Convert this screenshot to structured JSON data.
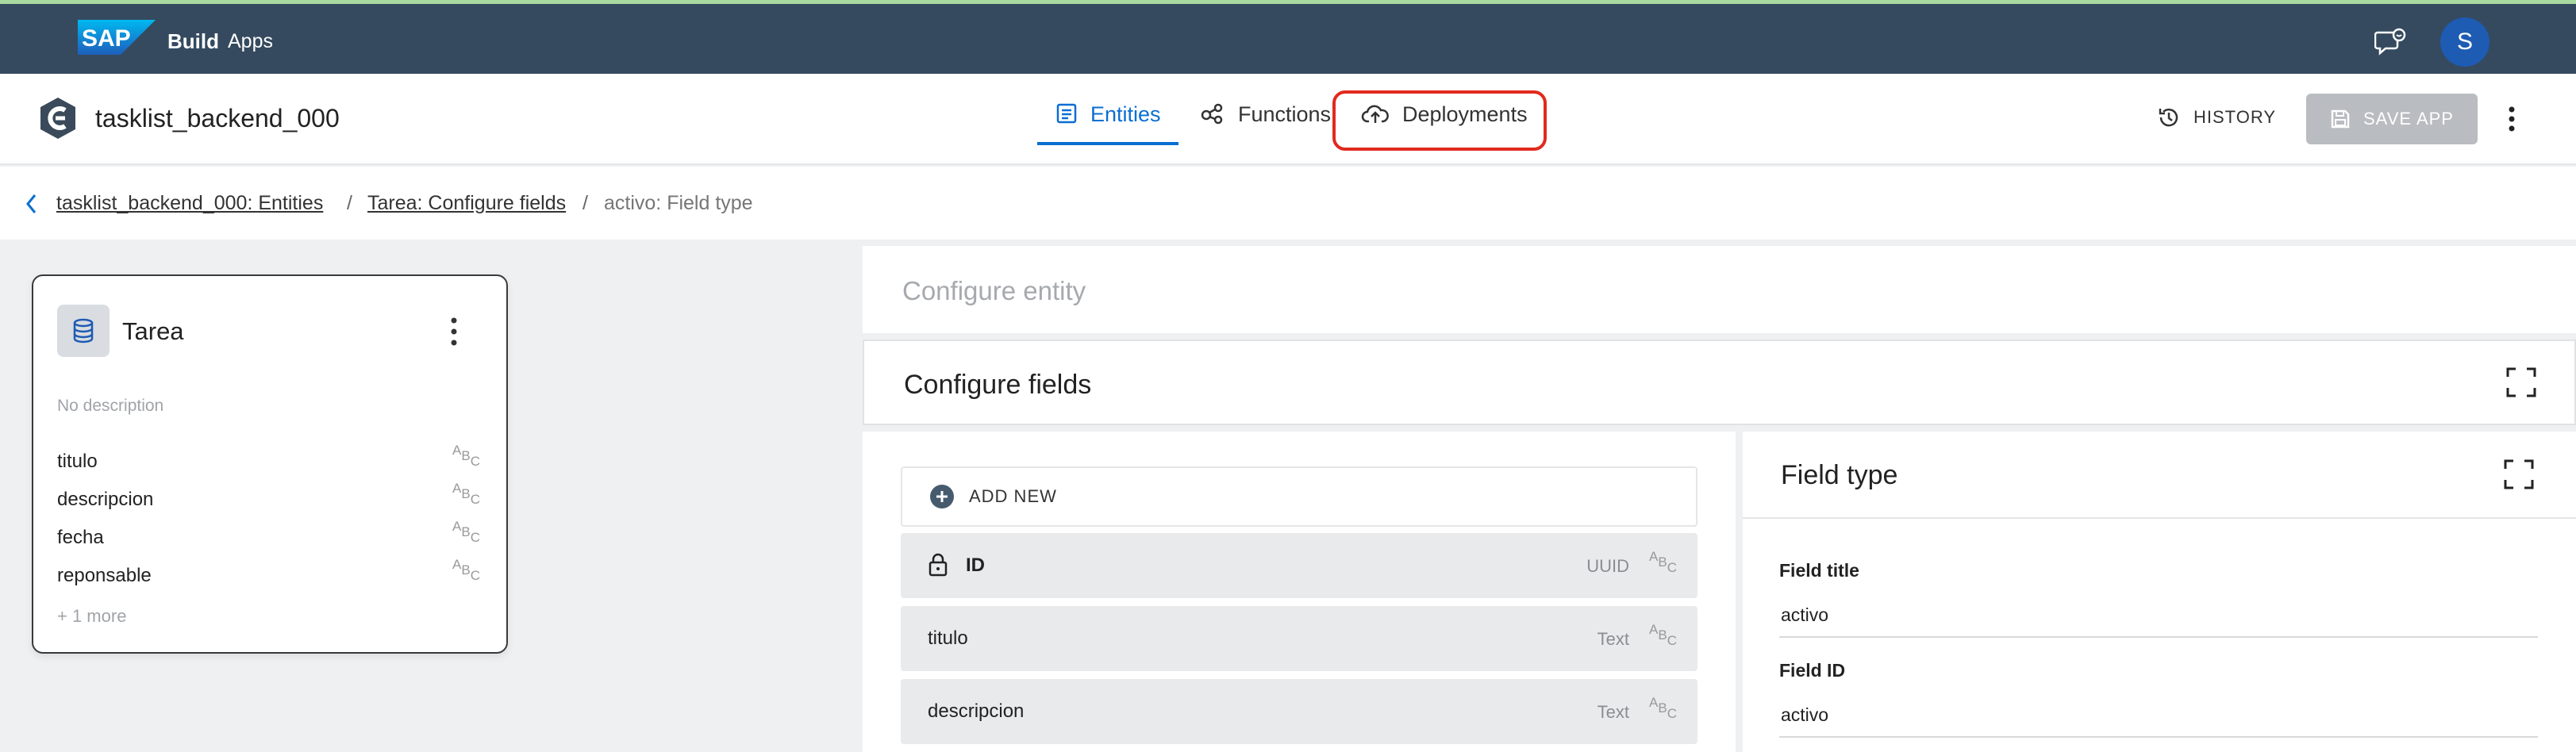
{
  "shell": {
    "logo_text": "SAP",
    "product": "Build",
    "section": "Apps",
    "avatar_initial": "S"
  },
  "app_header": {
    "title": "tasklist_backend_000",
    "tabs": [
      {
        "label": "Entities",
        "active": true
      },
      {
        "label": "Functions",
        "active": false
      },
      {
        "label": "Deployments",
        "active": false,
        "highlighted": true
      }
    ],
    "history_label": "HISTORY",
    "save_label": "SAVE APP"
  },
  "breadcrumb": {
    "items": [
      "tasklist_backend_000: Entities",
      "Tarea: Configure fields",
      "activo: Field type"
    ],
    "separator": "/"
  },
  "entity_card": {
    "name": "Tarea",
    "description": "No description",
    "fields": [
      "titulo",
      "descripcion",
      "fecha",
      "reponsable"
    ],
    "more": "+ 1 more"
  },
  "abc_glyph": {
    "a": "A",
    "b": "B",
    "c": "C"
  },
  "configure_entity": {
    "title": "Configure entity"
  },
  "configure_fields": {
    "title": "Configure fields",
    "add_new_label": "ADD NEW",
    "rows": [
      {
        "name": "ID",
        "type": "UUID",
        "locked": true
      },
      {
        "name": "titulo",
        "type": "Text",
        "locked": false
      },
      {
        "name": "descripcion",
        "type": "Text",
        "locked": false
      }
    ]
  },
  "field_type": {
    "title": "Field type",
    "field_title_label": "Field title",
    "field_title_value": "activo",
    "field_id_label": "Field ID",
    "field_id_value": "activo"
  },
  "colors": {
    "shellbar": "#354a5f",
    "accent": "#0a6ed1",
    "highlight": "#e12a1e",
    "avatar": "#1e5bb3"
  }
}
